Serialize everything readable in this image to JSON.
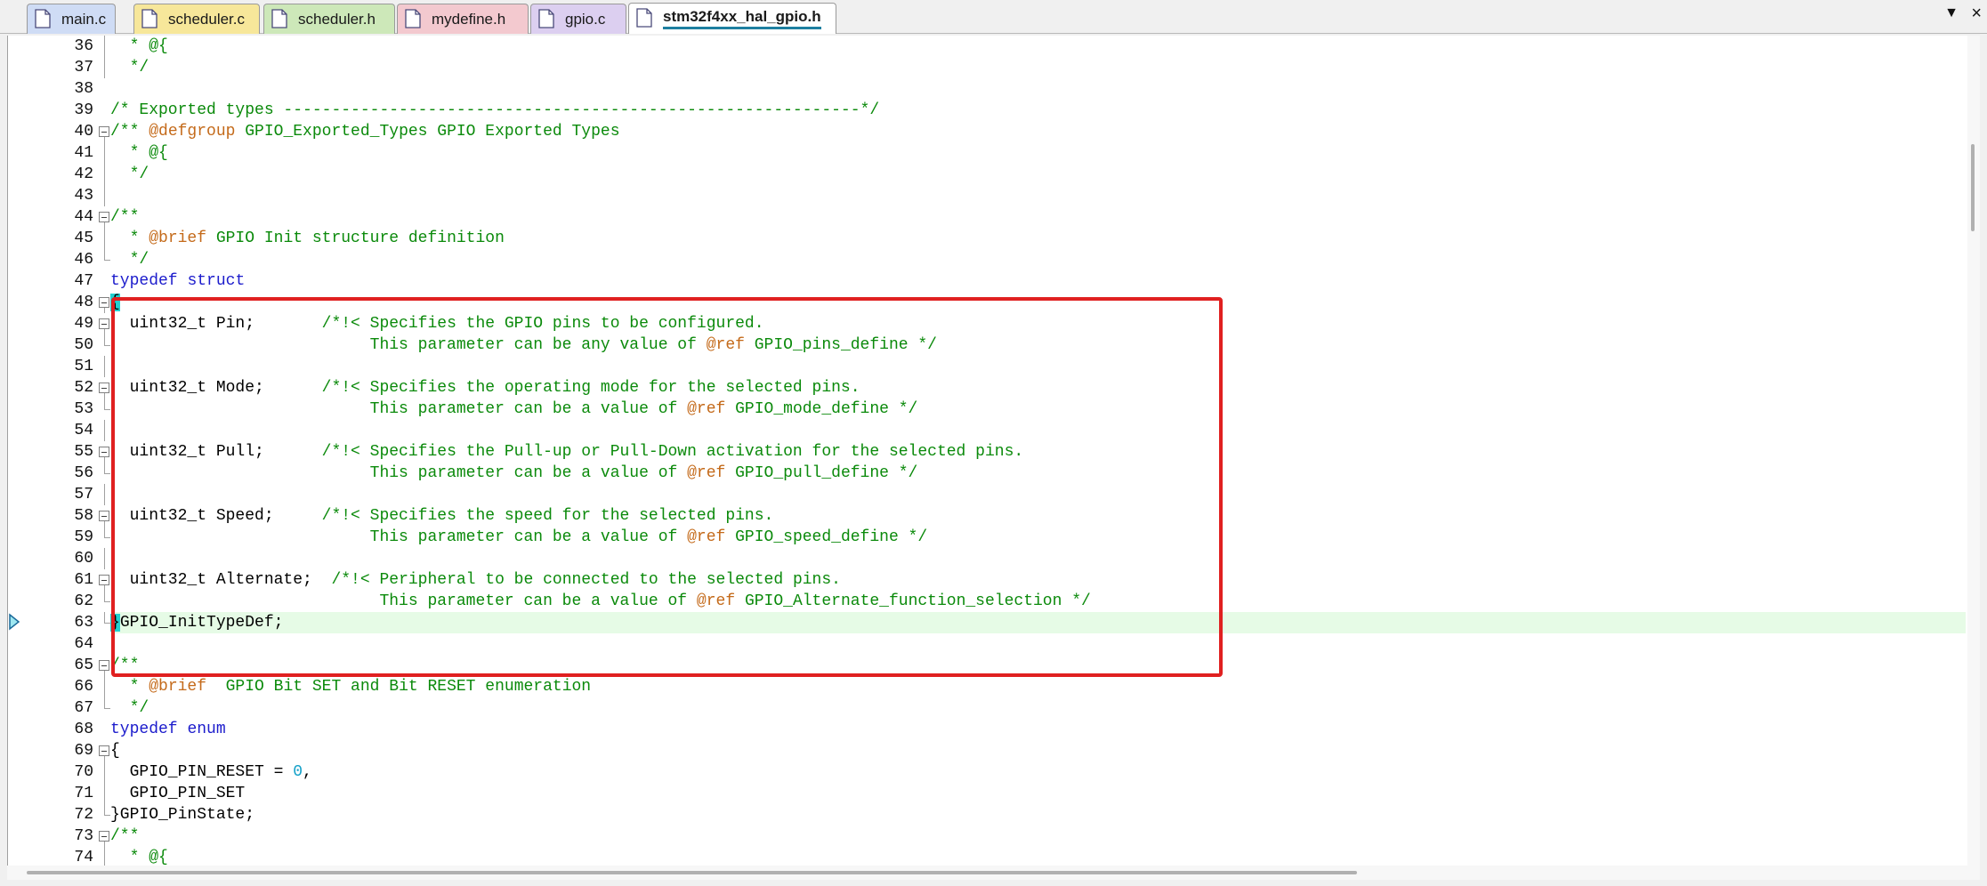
{
  "tabs": [
    {
      "label": "main.c",
      "color": "#cfdcf5",
      "icon": "c-file-icon"
    },
    {
      "label": "scheduler.c",
      "color": "#f7e79a",
      "icon": "c-file-icon"
    },
    {
      "label": "scheduler.h",
      "color": "#cde8b9",
      "icon": "h-file-icon"
    },
    {
      "label": "mydefine.h",
      "color": "#f3c9cf",
      "icon": "h-file-icon"
    },
    {
      "label": "gpio.c",
      "color": "#dccff0",
      "icon": "c-file-icon"
    },
    {
      "label": "stm32f4xx_hal_gpio.h",
      "color": "#ffffff",
      "icon": "h-file-icon",
      "active": true
    }
  ],
  "tab_menu_icon": "chevron-down-icon",
  "tab_close_icon": "close-icon",
  "editor": {
    "current_line": 63,
    "lines": [
      {
        "n": "36",
        "fold": "line",
        "segs": [
          [
            "cmt",
            "  * @{"
          ]
        ]
      },
      {
        "n": "37",
        "fold": "line",
        "segs": [
          [
            "cmt",
            "  */"
          ]
        ]
      },
      {
        "n": "38",
        "fold": "none",
        "segs": []
      },
      {
        "n": "39",
        "fold": "none",
        "segs": [
          [
            "cmt",
            "/* Exported types ------------------------------------------------------------*/"
          ]
        ]
      },
      {
        "n": "40",
        "fold": "box",
        "segs": [
          [
            "cmt",
            "/** "
          ],
          [
            "tag",
            "@defgroup"
          ],
          [
            "cmt",
            " GPIO_Exported_Types GPIO Exported Types"
          ]
        ]
      },
      {
        "n": "41",
        "fold": "line",
        "segs": [
          [
            "cmt",
            "  * @{"
          ]
        ]
      },
      {
        "n": "42",
        "fold": "line",
        "segs": [
          [
            "cmt",
            "  */"
          ]
        ]
      },
      {
        "n": "43",
        "fold": "line",
        "segs": []
      },
      {
        "n": "44",
        "fold": "box",
        "segs": [
          [
            "cmt",
            "/**"
          ]
        ]
      },
      {
        "n": "45",
        "fold": "line",
        "segs": [
          [
            "cmt",
            "  * "
          ],
          [
            "tag",
            "@brief"
          ],
          [
            "cmt",
            " GPIO Init structure definition"
          ]
        ]
      },
      {
        "n": "46",
        "fold": "corner",
        "segs": [
          [
            "cmt",
            "  */"
          ]
        ]
      },
      {
        "n": "47",
        "fold": "none",
        "segs": [
          [
            "kw",
            "typedef"
          ],
          [
            "txt",
            " "
          ],
          [
            "kw",
            "struct"
          ]
        ]
      },
      {
        "n": "48",
        "fold": "box",
        "segs": [
          [
            "brace",
            "{"
          ]
        ]
      },
      {
        "n": "49",
        "fold": "box",
        "segs": [
          [
            "txt",
            "  uint32_t Pin;       "
          ],
          [
            "cmt",
            "/*!< Specifies the GPIO pins to be configured."
          ]
        ]
      },
      {
        "n": "50",
        "fold": "corner",
        "segs": [
          [
            "cmt",
            "                           This parameter can be any value of "
          ],
          [
            "tag",
            "@ref"
          ],
          [
            "cmt",
            " GPIO_pins_define */"
          ]
        ]
      },
      {
        "n": "51",
        "fold": "line",
        "segs": []
      },
      {
        "n": "52",
        "fold": "box",
        "segs": [
          [
            "txt",
            "  uint32_t Mode;      "
          ],
          [
            "cmt",
            "/*!< Specifies the operating mode for the selected pins."
          ]
        ]
      },
      {
        "n": "53",
        "fold": "corner",
        "segs": [
          [
            "cmt",
            "                           This parameter can be a value of "
          ],
          [
            "tag",
            "@ref"
          ],
          [
            "cmt",
            " GPIO_mode_define */"
          ]
        ]
      },
      {
        "n": "54",
        "fold": "line",
        "segs": []
      },
      {
        "n": "55",
        "fold": "box",
        "segs": [
          [
            "txt",
            "  uint32_t Pull;      "
          ],
          [
            "cmt",
            "/*!< Specifies the Pull-up or Pull-Down activation for the selected pins."
          ]
        ]
      },
      {
        "n": "56",
        "fold": "corner",
        "segs": [
          [
            "cmt",
            "                           This parameter can be a value of "
          ],
          [
            "tag",
            "@ref"
          ],
          [
            "cmt",
            " GPIO_pull_define */"
          ]
        ]
      },
      {
        "n": "57",
        "fold": "line",
        "segs": []
      },
      {
        "n": "58",
        "fold": "box",
        "segs": [
          [
            "txt",
            "  uint32_t Speed;     "
          ],
          [
            "cmt",
            "/*!< Specifies the speed for the selected pins."
          ]
        ]
      },
      {
        "n": "59",
        "fold": "corner",
        "segs": [
          [
            "cmt",
            "                           This parameter can be a value of "
          ],
          [
            "tag",
            "@ref"
          ],
          [
            "cmt",
            " GPIO_speed_define */"
          ]
        ]
      },
      {
        "n": "60",
        "fold": "line",
        "segs": []
      },
      {
        "n": "61",
        "fold": "box",
        "segs": [
          [
            "txt",
            "  uint32_t Alternate;  "
          ],
          [
            "cmt",
            "/*!< Peripheral to be connected to the selected pins."
          ]
        ]
      },
      {
        "n": "62",
        "fold": "corner",
        "segs": [
          [
            "cmt",
            "                            This parameter can be a value of "
          ],
          [
            "tag",
            "@ref"
          ],
          [
            "cmt",
            " GPIO_Alternate_function_selection */"
          ]
        ]
      },
      {
        "n": "63",
        "fold": "corner",
        "segs": [
          [
            "brace",
            "}"
          ],
          [
            "txt",
            "GPIO_InitTypeDef;"
          ]
        ]
      },
      {
        "n": "64",
        "fold": "none",
        "segs": []
      },
      {
        "n": "65",
        "fold": "box",
        "segs": [
          [
            "cmt",
            "/**"
          ]
        ]
      },
      {
        "n": "66",
        "fold": "line",
        "segs": [
          [
            "cmt",
            "  * "
          ],
          [
            "tag",
            "@brief"
          ],
          [
            "cmt",
            "  GPIO Bit SET and Bit RESET enumeration"
          ]
        ]
      },
      {
        "n": "67",
        "fold": "corner",
        "segs": [
          [
            "cmt",
            "  */"
          ]
        ]
      },
      {
        "n": "68",
        "fold": "none",
        "segs": [
          [
            "kw",
            "typedef"
          ],
          [
            "txt",
            " "
          ],
          [
            "kw",
            "enum"
          ]
        ]
      },
      {
        "n": "69",
        "fold": "box",
        "segs": [
          [
            "txt",
            "{"
          ]
        ]
      },
      {
        "n": "70",
        "fold": "line",
        "segs": [
          [
            "txt",
            "  GPIO_PIN_RESET = "
          ],
          [
            "num",
            "0"
          ],
          [
            "txt",
            ","
          ]
        ]
      },
      {
        "n": "71",
        "fold": "line",
        "segs": [
          [
            "txt",
            "  GPIO_PIN_SET"
          ]
        ]
      },
      {
        "n": "72",
        "fold": "corner",
        "segs": [
          [
            "txt",
            "}GPIO_PinState;"
          ]
        ]
      },
      {
        "n": "73",
        "fold": "box",
        "segs": [
          [
            "cmt",
            "/**"
          ]
        ]
      },
      {
        "n": "74",
        "fold": "line",
        "segs": [
          [
            "cmt",
            "  * @{"
          ]
        ]
      }
    ]
  }
}
